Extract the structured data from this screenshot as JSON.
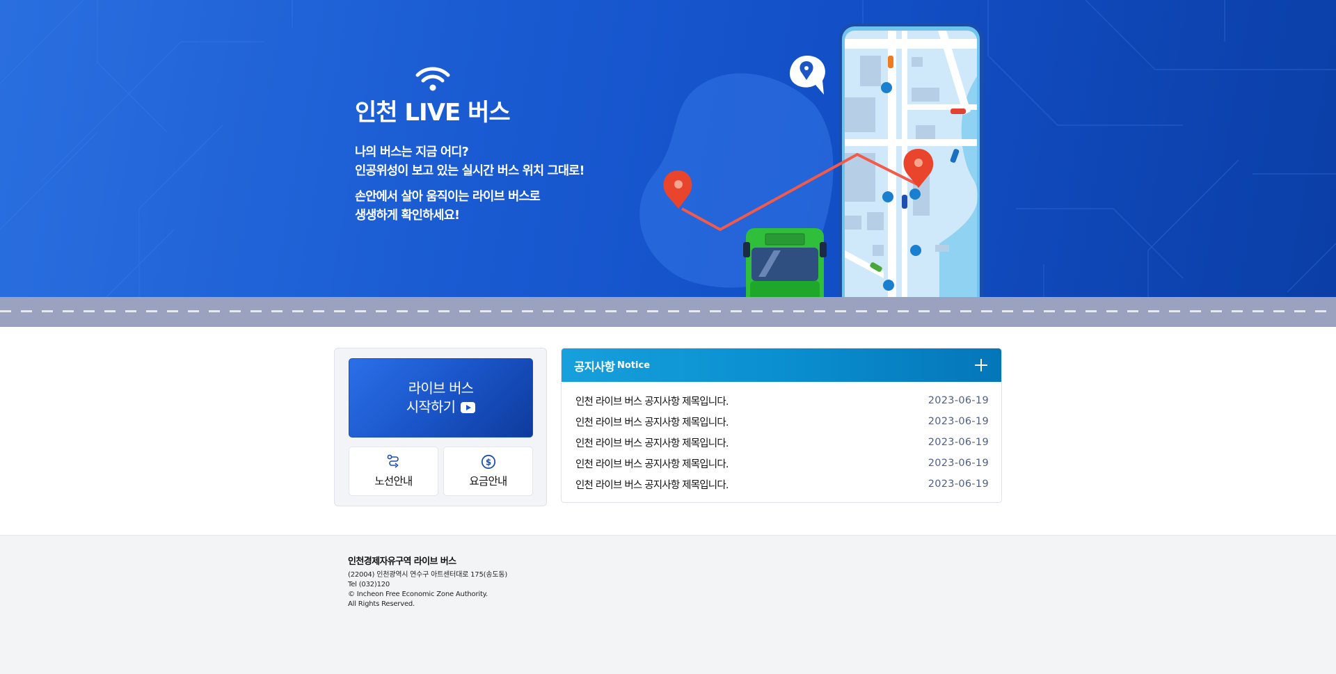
{
  "hero": {
    "title": "인천 LIVE 버스",
    "desc_line1": "나의 버스는 지금 어디?",
    "desc_line2": "인공위성이 보고 있는 실시간 버스 위치 그대로!",
    "desc_line3": "손안에서 살아 움직이는 라이브 버스로",
    "desc_line4": "생생하게 확인하세요!"
  },
  "quick": {
    "live_line1": "라이브 버스",
    "live_line2": "시작하기",
    "route_label": "노선안내",
    "fare_label": "요금안내"
  },
  "notice": {
    "title": "공지사항",
    "subtitle": "Notice",
    "items": [
      {
        "title": "인천 라이브 버스 공지사항 제목입니다.",
        "date": "2023-06-19"
      },
      {
        "title": "인천 라이브 버스 공지사항 제목입니다.",
        "date": "2023-06-19"
      },
      {
        "title": "인천 라이브 버스 공지사항 제목입니다.",
        "date": "2023-06-19"
      },
      {
        "title": "인천 라이브 버스 공지사항 제목입니다.",
        "date": "2023-06-19"
      },
      {
        "title": "인천 라이브 버스 공지사항 제목입니다.",
        "date": "2023-06-19"
      }
    ]
  },
  "footer": {
    "org": "인천경제자유구역 라이브 버스",
    "address": "(22004) 인천광역시 연수구 아트센터대로 175(송도동)",
    "tel": "Tel (032)120",
    "copyright": "© Incheon Free Economic Zone Authority.",
    "rights": "All Rights Reserved."
  },
  "colors": {
    "hero_blue": "#1a5bd2",
    "notice_header": "#0a8fd0",
    "bus_green": "#2fbf3a",
    "pin_red": "#e8452c"
  }
}
